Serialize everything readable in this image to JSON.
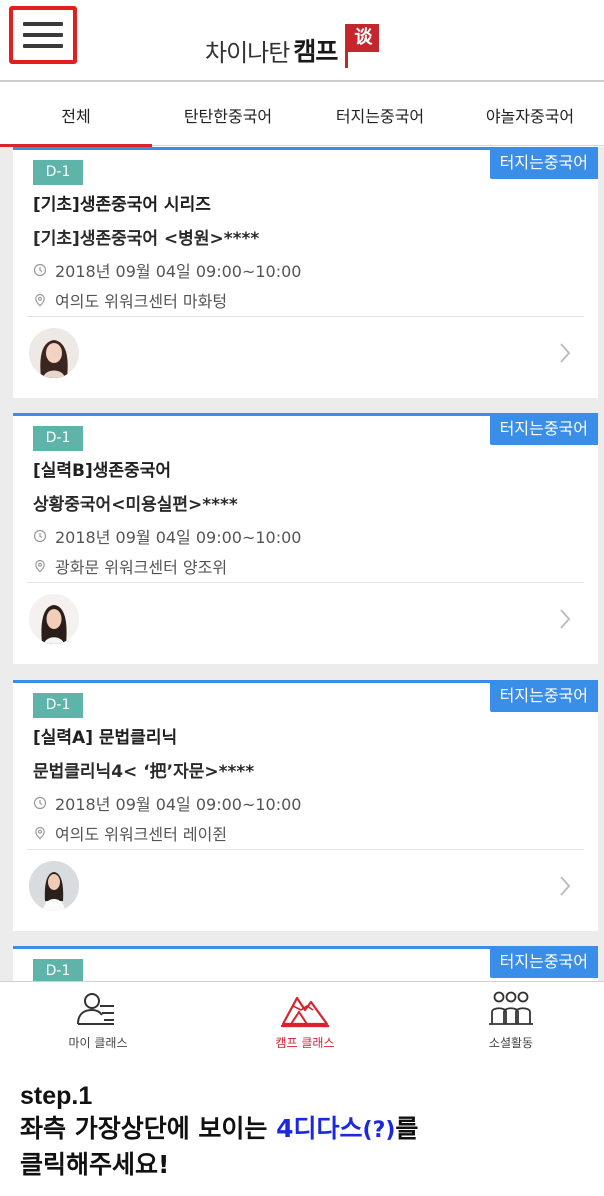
{
  "header": {
    "brand_light": "차이나탄",
    "brand_bold": "캠프",
    "brand_flag_char": "谈"
  },
  "tabs": [
    {
      "label": "전체",
      "active": true
    },
    {
      "label": "탄탄한중국어",
      "active": false
    },
    {
      "label": "터지는중국어",
      "active": false
    },
    {
      "label": "야놀자중국어",
      "active": false
    }
  ],
  "cards": [
    {
      "dday": "D-1",
      "category": "터지는중국어",
      "title": "[기초]생존중국어 시리즈",
      "subtitle": "[기초]생존중국어 <병원>****",
      "time": "2018년 09월 04일 09:00~10:00",
      "place": "여의도 위워크센터 마화텅"
    },
    {
      "dday": "D-1",
      "category": "터지는중국어",
      "title": "[실력B]생존중국어",
      "subtitle": "상황중국어<미용실편>****",
      "time": "2018년 09월 04일 09:00~10:00",
      "place": "광화문 위워크센터 양조위"
    },
    {
      "dday": "D-1",
      "category": "터지는중국어",
      "title": "[실력A] 문법클리닉",
      "subtitle": "문법클리닉4< ‘把’자문>****",
      "time": "2018년 09월 04일 09:00~10:00",
      "place": "여의도 위워크센터 레이쥔"
    },
    {
      "dday": "D-1",
      "category": "터지는중국어"
    }
  ],
  "bottom_nav": [
    {
      "label": "마이 클래스",
      "icon": "my-class-icon"
    },
    {
      "label": "캠프 클래스",
      "icon": "camp-class-icon",
      "active": true
    },
    {
      "label": "소셜활동",
      "icon": "social-icon"
    }
  ],
  "instruction": {
    "step": "step.1",
    "line1_prefix": "좌측 가장상단에 보이는 ",
    "line1_highlight_a": "4디다스",
    "line1_highlight_b": "(?)",
    "line1_suffix": "를",
    "line2": "클릭해주세요!"
  },
  "colors": {
    "accent_red": "#d9232d",
    "category_blue": "#3b8ee8",
    "dday_teal": "#5fb4a9",
    "highlight_blue": "#1a28e0",
    "menu_outline_red": "#e41e1e"
  }
}
